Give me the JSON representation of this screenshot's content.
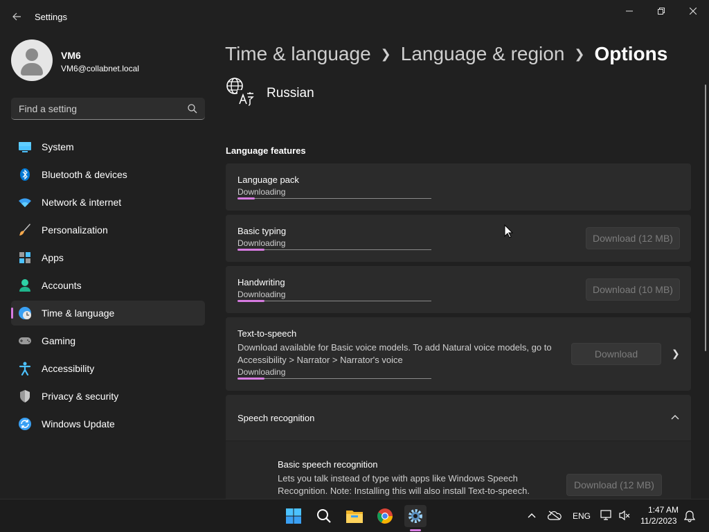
{
  "window": {
    "title": "Settings",
    "controls": {
      "minimize": "minimize-icon",
      "maximize": "restore-icon",
      "close": "close-icon"
    }
  },
  "profile": {
    "name": "VM6",
    "email": "VM6@collabnet.local"
  },
  "search": {
    "placeholder": "Find a setting",
    "value": ""
  },
  "nav": {
    "items": [
      {
        "label": "System",
        "icon": "monitor-icon"
      },
      {
        "label": "Bluetooth & devices",
        "icon": "bluetooth-icon"
      },
      {
        "label": "Network & internet",
        "icon": "wifi-icon"
      },
      {
        "label": "Personalization",
        "icon": "brush-icon"
      },
      {
        "label": "Apps",
        "icon": "apps-icon"
      },
      {
        "label": "Accounts",
        "icon": "person-icon"
      },
      {
        "label": "Time & language",
        "icon": "globe-clock-icon",
        "active": true
      },
      {
        "label": "Gaming",
        "icon": "gamepad-icon"
      },
      {
        "label": "Accessibility",
        "icon": "accessibility-icon"
      },
      {
        "label": "Privacy & security",
        "icon": "shield-icon"
      },
      {
        "label": "Windows Update",
        "icon": "update-icon"
      }
    ]
  },
  "breadcrumb": {
    "items": [
      "Time & language",
      "Language & region"
    ],
    "current": "Options"
  },
  "language": {
    "name": "Russian"
  },
  "features": {
    "title": "Language features",
    "language_pack": {
      "title": "Language pack",
      "status": "Downloading",
      "progress": 0.09
    },
    "basic_typing": {
      "title": "Basic typing",
      "status": "Downloading",
      "progress": 0.14,
      "button": "Download (12 MB)"
    },
    "handwriting": {
      "title": "Handwriting",
      "status": "Downloading",
      "progress": 0.14,
      "button": "Download (10 MB)"
    },
    "tts": {
      "title": "Text-to-speech",
      "desc": "Download available for Basic voice models. To add Natural voice models, go to Accessibility > Narrator > Narrator's voice",
      "status": "Downloading",
      "progress": 0.14,
      "button": "Download"
    },
    "speech": {
      "title": "Speech recognition",
      "sub_title": "Basic speech recognition",
      "sub_desc": "Lets you talk instead of type with apps like Windows Speech Recognition. Note: Installing this will also install Text-to-speech.",
      "sub_button": "Download (12 MB)"
    }
  },
  "colors": {
    "accent": "#d67be0",
    "background": "#202020",
    "card": "#2b2b2b"
  },
  "taskbar": {
    "apps": [
      "windows-start-icon",
      "search-icon",
      "file-explorer-icon",
      "chrome-icon",
      "settings-gear-icon"
    ],
    "tray": {
      "language": "ENG",
      "time": "1:47 AM",
      "date": "11/2/2023"
    }
  }
}
